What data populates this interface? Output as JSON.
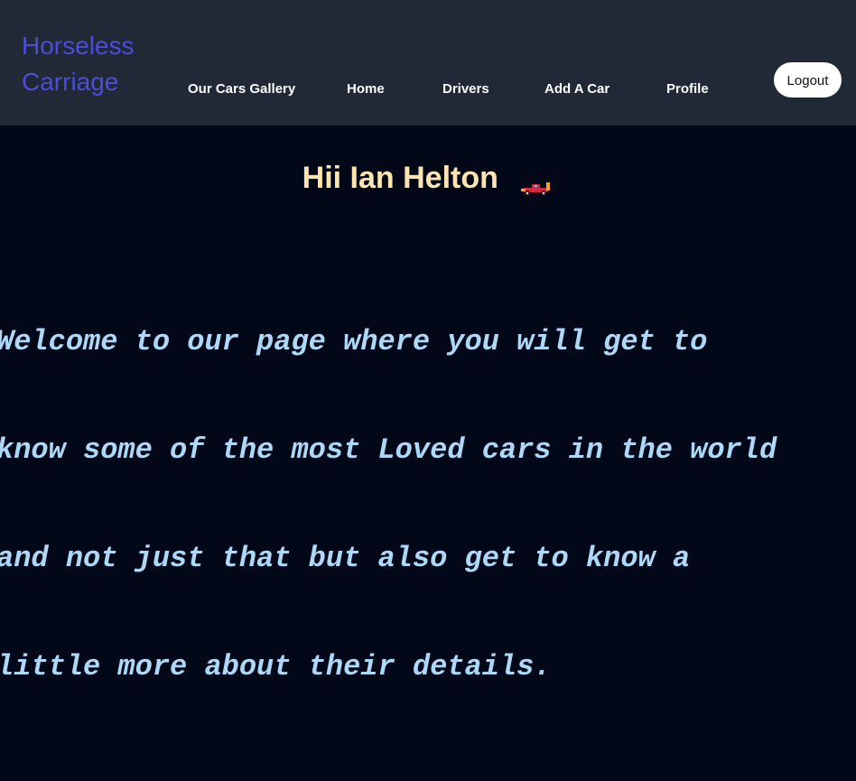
{
  "brand": {
    "line1": "Horseless",
    "line2": "Carriage"
  },
  "nav": {
    "items": [
      {
        "label": "Our Cars Gallery"
      },
      {
        "label": "Home"
      },
      {
        "label": "Drivers"
      },
      {
        "label": "Add A Car"
      },
      {
        "label": "Profile"
      }
    ],
    "logout_label": "Logout"
  },
  "main": {
    "greeting": "Hii Ian Helton",
    "greeting_icon": "race-car-icon",
    "welcome_lines": [
      "Welcome to our page where you will get to",
      "know some of the most Loved cars in the world",
      "and not just that but also get to know a",
      "little more about their details."
    ]
  },
  "colors": {
    "navbar_bg": "#212836",
    "page_bg": "#020817",
    "brand": "#4a4ed8",
    "greeting": "#fde4b0",
    "welcome_text": "#aed8f7"
  }
}
